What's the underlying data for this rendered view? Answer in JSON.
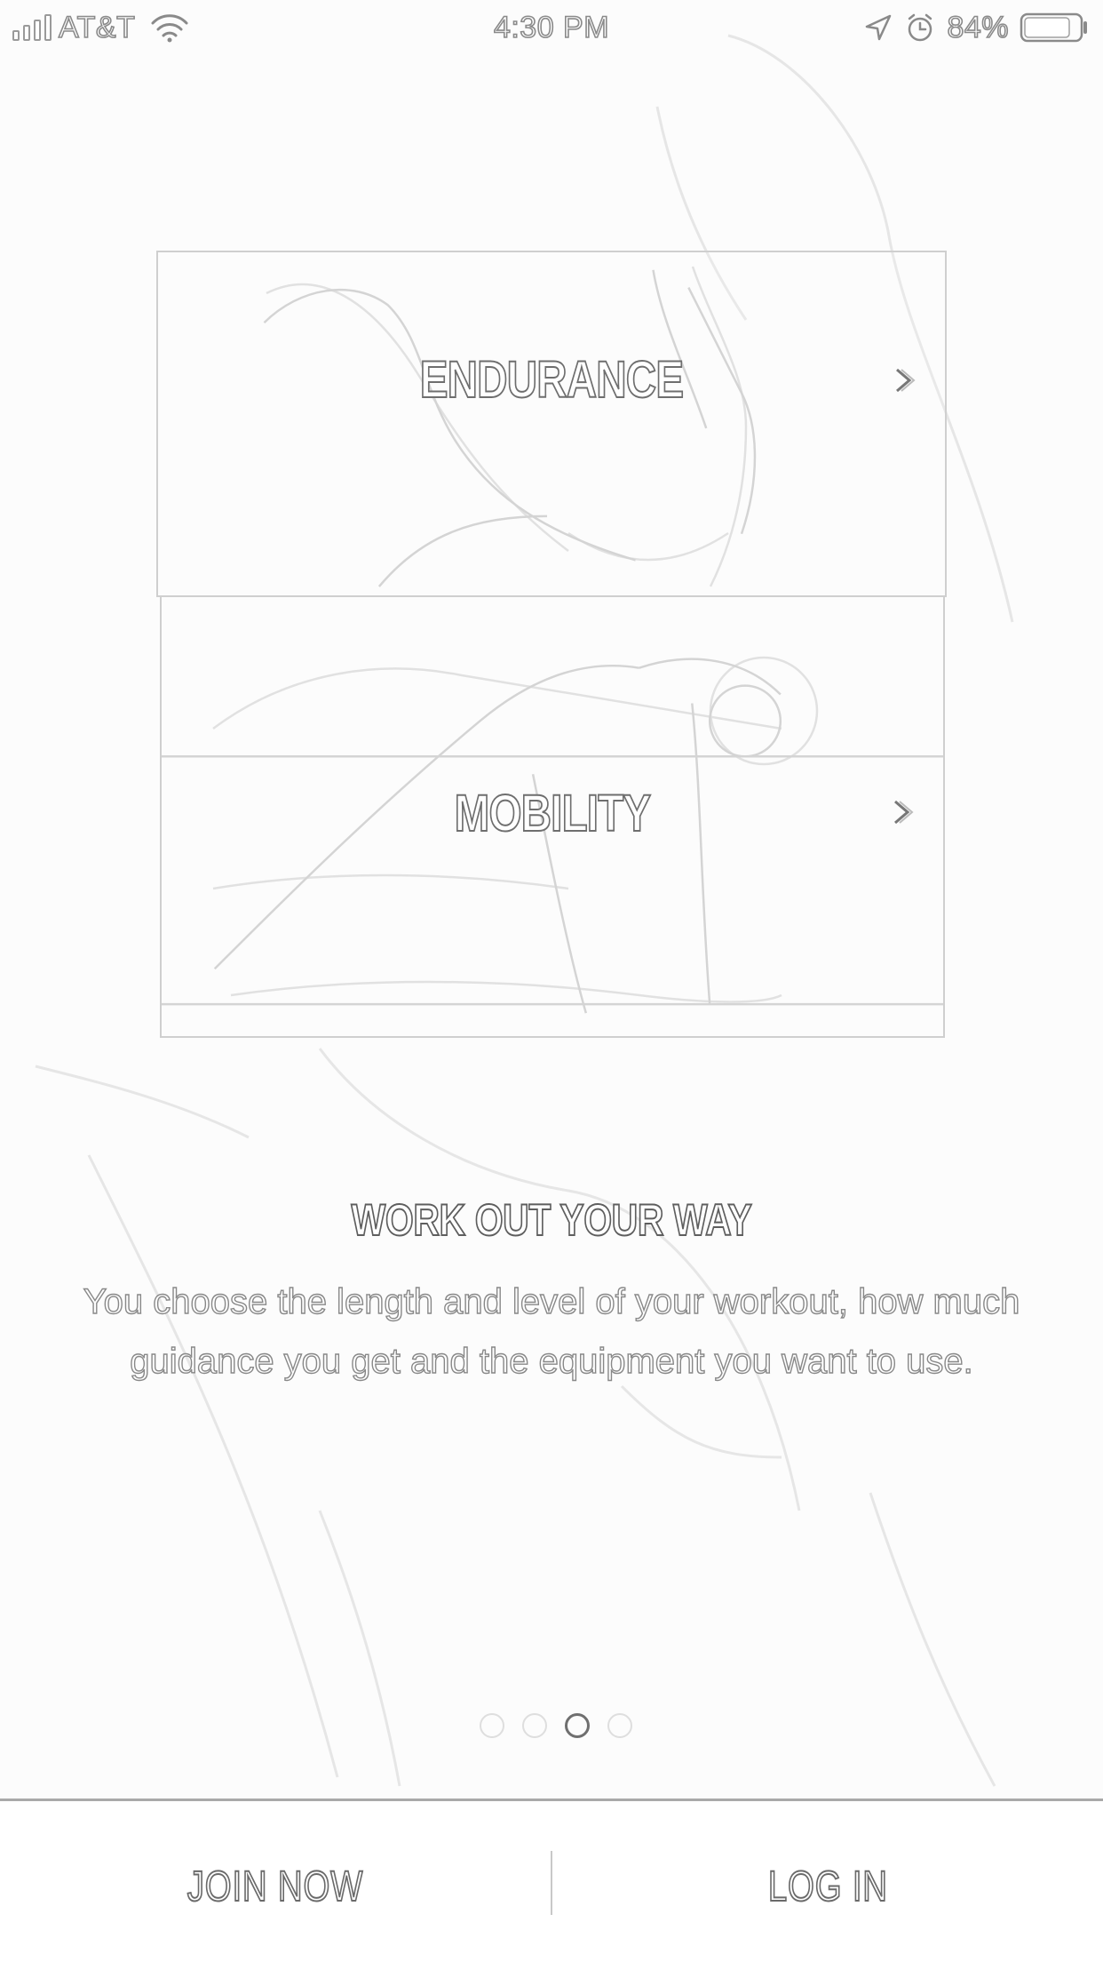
{
  "status_bar": {
    "carrier": "AT&T",
    "time": "4:30 PM",
    "battery_percent": "84%",
    "battery_level": 0.84,
    "icons": [
      "signal-icon",
      "wifi-icon",
      "location-icon",
      "alarm-icon",
      "battery-icon"
    ]
  },
  "cards": [
    {
      "label": "ENDURANCE",
      "icon": "chevron-right-icon"
    },
    {
      "label": "MOBILITY",
      "icon": "chevron-right-icon"
    }
  ],
  "intro": {
    "headline": "WORK OUT YOUR WAY",
    "description": "You choose the length and level of your workout, how much guidance you get and the equipment you want to use."
  },
  "pager": {
    "count": 4,
    "active_index": 2
  },
  "bottom_bar": {
    "join_label": "JOIN NOW",
    "login_label": "LOG IN"
  },
  "colors": {
    "background": "#fcfcfc",
    "outline_text": "#6e6e6e",
    "divider": "#a9a9a9"
  }
}
